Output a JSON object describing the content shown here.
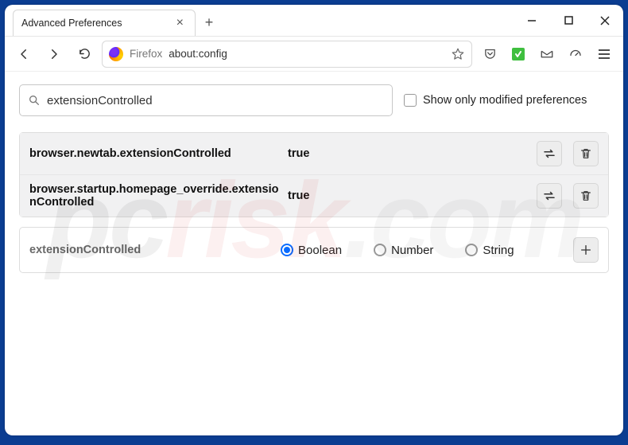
{
  "window": {
    "tab_title": "Advanced Preferences"
  },
  "urlbar": {
    "scheme_label": "Firefox",
    "url": "about:config"
  },
  "search": {
    "value": "extensionControlled"
  },
  "filter": {
    "checkbox_label": "Show only modified preferences"
  },
  "prefs": [
    {
      "name": "browser.newtab.extensionControlled",
      "value": "true"
    },
    {
      "name": "browser.startup.homepage_override.extensionControlled",
      "value": "true"
    }
  ],
  "new_pref": {
    "name": "extensionControlled",
    "types": [
      "Boolean",
      "Number",
      "String"
    ],
    "selected": "Boolean"
  },
  "watermark": {
    "a": "pc",
    "b": "risk",
    "c": ".com"
  }
}
